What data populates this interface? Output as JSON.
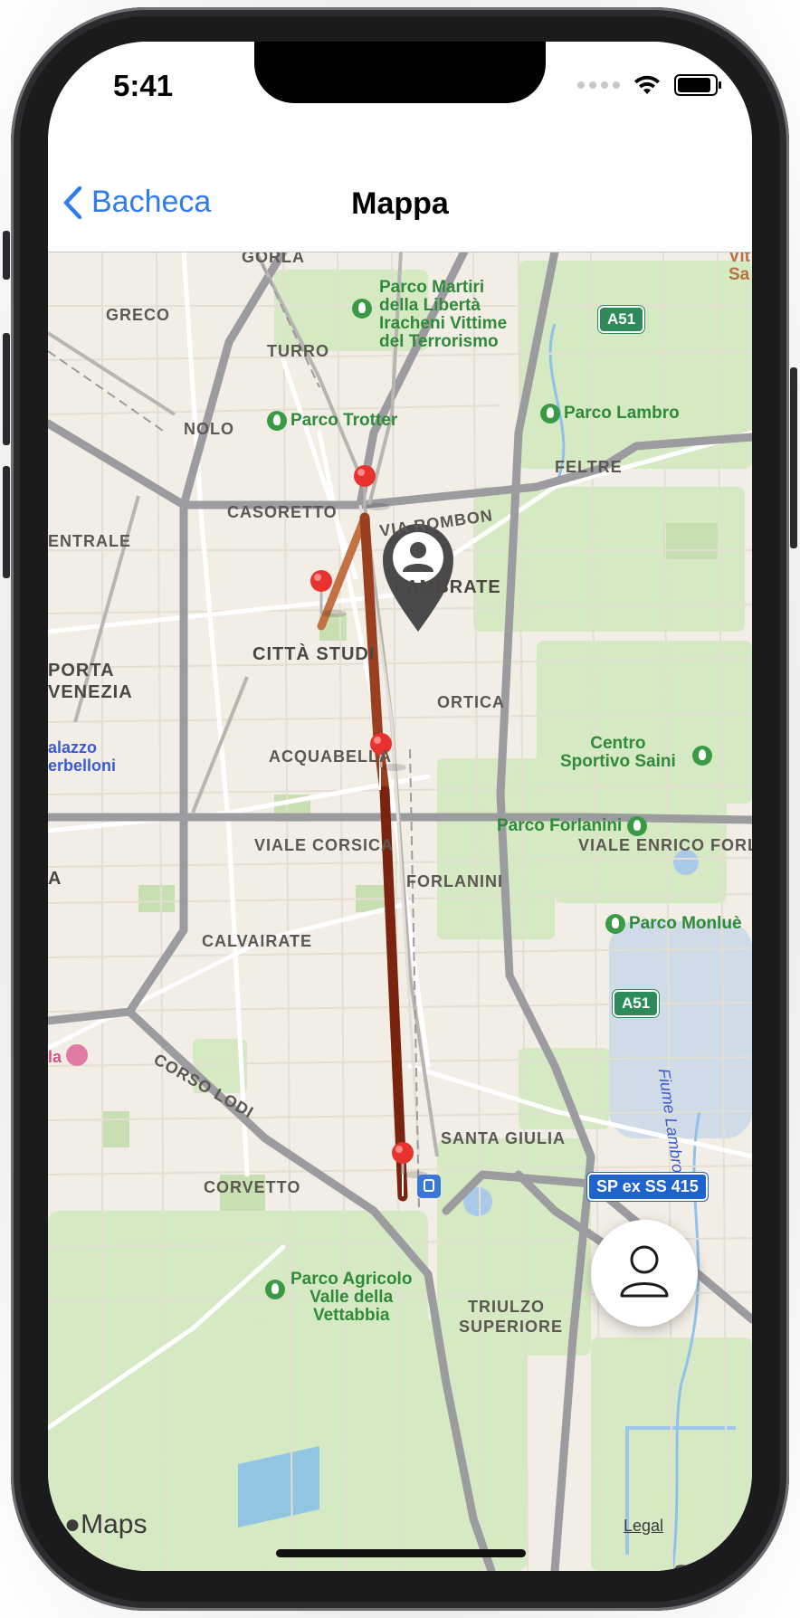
{
  "status_bar": {
    "time": "5:41"
  },
  "nav": {
    "back_label": "Bacheca",
    "title": "Mappa"
  },
  "map": {
    "labels": {
      "gorla": "GORLA",
      "greco": "GRECO",
      "turro": "TURRO",
      "nolo": "NOLO",
      "casoretto": "CASORETTO",
      "centrale": "ENTRALE",
      "lambrate": "LAMBRATE",
      "citta_studi": "CITTÀ STUDI",
      "porta_venezia_1": "PORTA",
      "porta_venezia_2": "VENEZIA",
      "ortica": "ORTICA",
      "acquabella": "ACQUABELLA",
      "feltre": "FELTRE",
      "forlanini": "FORLANINI",
      "calvairate": "CALVAIRATE",
      "santa_giulia": "SANTA GIULIA",
      "corvetto": "CORVETTO",
      "triulzo_1": "TRIULZO",
      "triulzo_2": "SUPERIORE",
      "a_left": "A",
      "via_rombon": "VIA ROMBON",
      "viale_corsica": "VIALE CORSICA",
      "viale_forlanini": "VIALE ENRICO FORLA",
      "corso_lodi": "CORSO LODI",
      "fiume_lambro": "Fiume Lambro",
      "san": "San"
    },
    "parks": {
      "martiri_1": "Parco Martiri",
      "martiri_2": "della Libertà",
      "martiri_3": "Iracheni Vittime",
      "martiri_4": "del Terrorismo",
      "trotter": "Parco Trotter",
      "lambro": "Parco Lambro",
      "centro_saini_1": "Centro",
      "centro_saini_2": "Sportivo Saini",
      "forlanini": "Parco Forlanini",
      "monlue": "Parco Monluè",
      "agricolo_1": "Parco Agricolo",
      "agricolo_2": "Valle della",
      "agricolo_3": "Vettabbia",
      "vit_1": "Vit",
      "vit_2": "Sa"
    },
    "blue_labels": {
      "palazzo_1": "alazzo",
      "palazzo_2": "erbelloni",
      "la": "la"
    },
    "shields": {
      "a51_top": "A51",
      "a51_mid": "A51",
      "ss415": "SP ex SS 415"
    },
    "route_color": "#8b2a14",
    "pin_color": "#e8322e",
    "user_marker_icon": "person-pin-icon",
    "maps_logo": "Maps",
    "legal": "Legal"
  },
  "fab": {
    "icon": "person-icon"
  }
}
